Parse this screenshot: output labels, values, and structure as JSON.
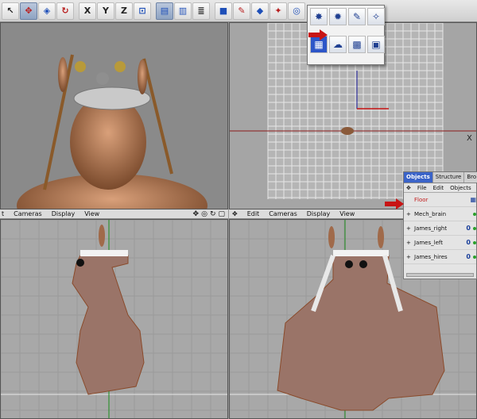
{
  "toolbar": {
    "tools": [
      {
        "name": "select-tool-icon",
        "glyph": "↖"
      },
      {
        "name": "move-tool-icon",
        "glyph": "✥"
      },
      {
        "name": "scale-tool-icon",
        "glyph": "◈"
      },
      {
        "name": "rotate-tool-icon",
        "glyph": "↻"
      },
      {
        "name": "x-axis-lock-icon",
        "glyph": "X"
      },
      {
        "name": "y-axis-lock-icon",
        "glyph": "Y"
      },
      {
        "name": "z-axis-lock-icon",
        "glyph": "Z"
      },
      {
        "name": "coordinate-system-icon",
        "glyph": "⊡"
      }
    ]
  },
  "palette": {
    "items": [
      "floor",
      "sky",
      "environment",
      "background",
      "stage",
      "foreground",
      "physical-sky",
      "light-add"
    ]
  },
  "left_menu": {
    "cut": "t",
    "cameras": "Cameras",
    "display": "Display",
    "view": "View"
  },
  "right_menu": {
    "edit": "Edit",
    "cameras": "Cameras",
    "display": "Display",
    "view": "View"
  },
  "top_view": {
    "axis_label": "X"
  },
  "objects": {
    "tabs": [
      "Objects",
      "Structure",
      "Bro"
    ],
    "menu": [
      "File",
      "Edit",
      "Objects"
    ],
    "rows": [
      {
        "name": "Floor",
        "expander": ""
      },
      {
        "name": "Mech_brain",
        "expander": "+"
      },
      {
        "name": "James_right",
        "expander": "+"
      },
      {
        "name": "James_left",
        "expander": "+"
      },
      {
        "name": "James_hires",
        "expander": "+"
      }
    ],
    "tag_label": "0"
  }
}
